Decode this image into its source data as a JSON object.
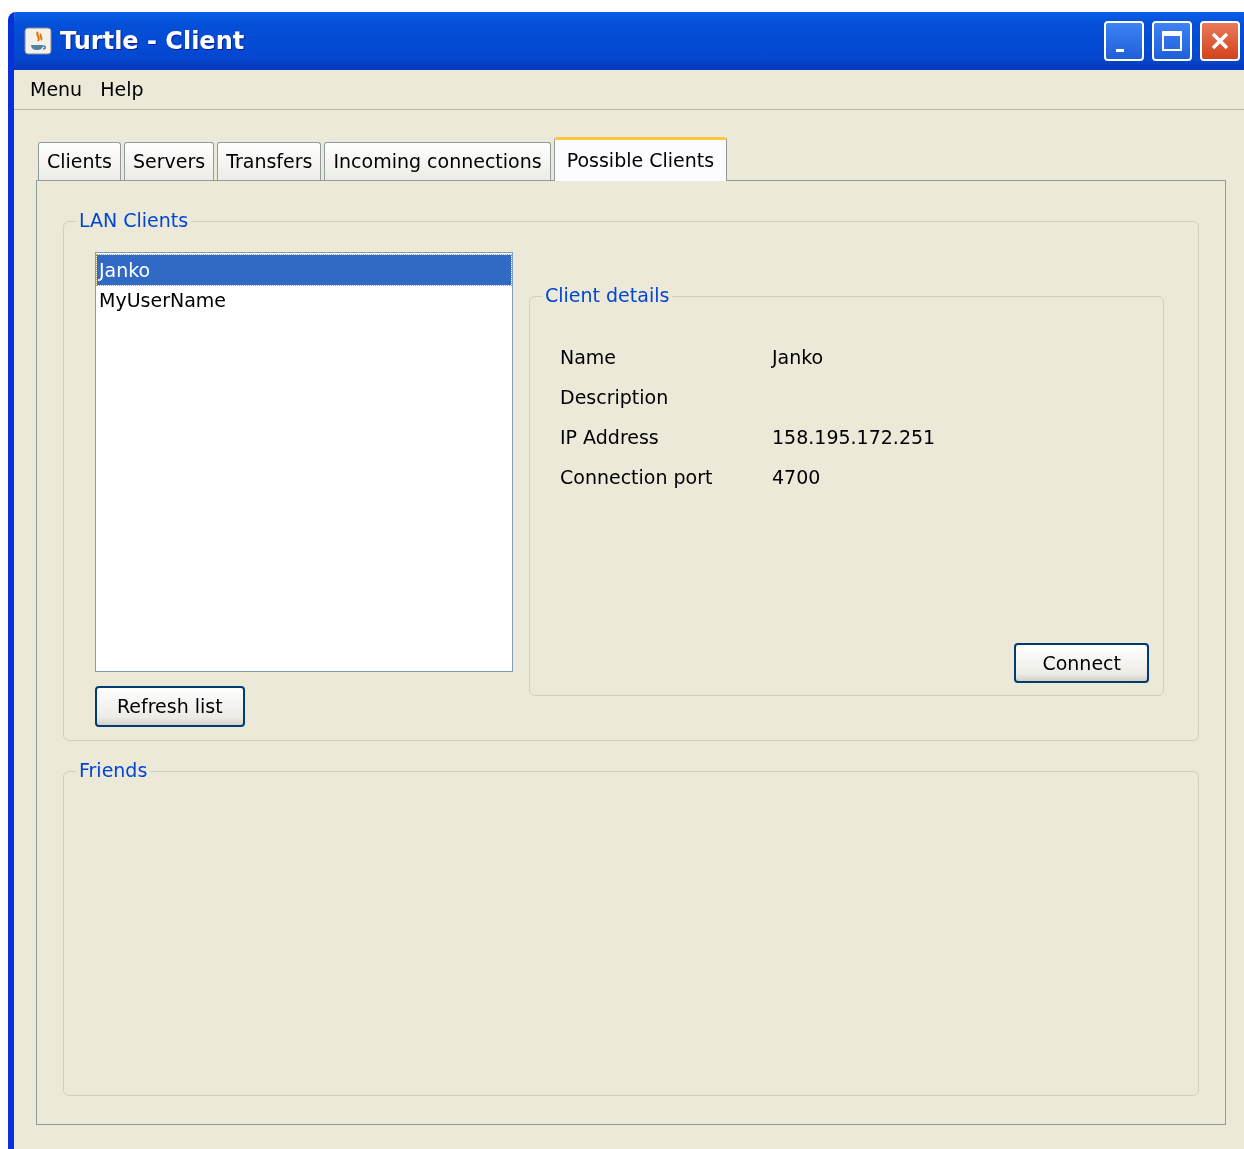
{
  "window": {
    "title": "Turtle - Client"
  },
  "menu": [
    {
      "label": "Menu"
    },
    {
      "label": "Help"
    }
  ],
  "tabs": [
    {
      "label": "Clients",
      "selected": false
    },
    {
      "label": "Servers",
      "selected": false
    },
    {
      "label": "Transfers",
      "selected": false
    },
    {
      "label": "Incoming connections",
      "selected": false
    },
    {
      "label": "Possible Clients",
      "selected": true
    }
  ],
  "lan_clients": {
    "title": "LAN Clients",
    "items": [
      {
        "label": "Janko",
        "selected": true
      },
      {
        "label": "MyUserName",
        "selected": false
      }
    ],
    "refresh_button": "Refresh list"
  },
  "client_details": {
    "title": "Client details",
    "fields": [
      {
        "label": "Name",
        "value": "Janko"
      },
      {
        "label": "Description"
      },
      {
        "label": "IP Address",
        "value": "158.195.172.251"
      },
      {
        "label": "Connection port",
        "value": "4700"
      }
    ],
    "connect_button": "Connect"
  },
  "friends": {
    "title": "Friends"
  }
}
